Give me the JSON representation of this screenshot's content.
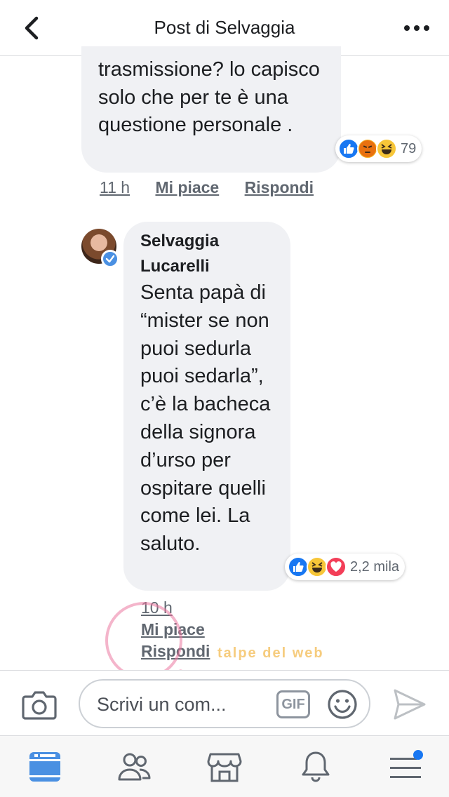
{
  "header": {
    "title": "Post di Selvaggia",
    "back_icon": "chevron-left-icon",
    "more_icon": "more-dots-icon"
  },
  "comments": [
    {
      "text": "trasmissione? lo capisco solo che per te è una questione personale .",
      "reactions": {
        "icons": [
          "like-icon",
          "angry-icon",
          "haha-icon"
        ],
        "count": "79"
      },
      "time": "11 h",
      "like_label": "Mi piace",
      "reply_label": "Rispondi"
    },
    {
      "author": "Selvaggia Lucarelli",
      "verified": true,
      "text": "Senta papà di “mister se non puoi sedurla puoi sedarla”, c’è la bacheca della signora d’urso per ospitare quelli come lei. La saluto.",
      "reactions": {
        "icons": [
          "like-icon",
          "haha-icon",
          "love-icon"
        ],
        "count": "2,2 mila"
      },
      "time": "10 h",
      "like_label": "Mi piace",
      "reply_label": "Rispondi"
    }
  ],
  "watermark": {
    "text": "talpe del web"
  },
  "composer": {
    "placeholder": "Scrivi un com...",
    "gif_label": "GIF"
  },
  "tabbar": {
    "items": [
      "news-feed-icon",
      "friends-icon",
      "marketplace-icon",
      "notifications-icon",
      "menu-icon"
    ],
    "active": "news-feed-icon",
    "menu_badge": true
  },
  "colors": {
    "accent": "#4267b2",
    "bubble": "#f0f1f4",
    "like": "#1877f2",
    "love": "#f33e58",
    "haha": "#f7c638",
    "angry": "#e9710f"
  }
}
